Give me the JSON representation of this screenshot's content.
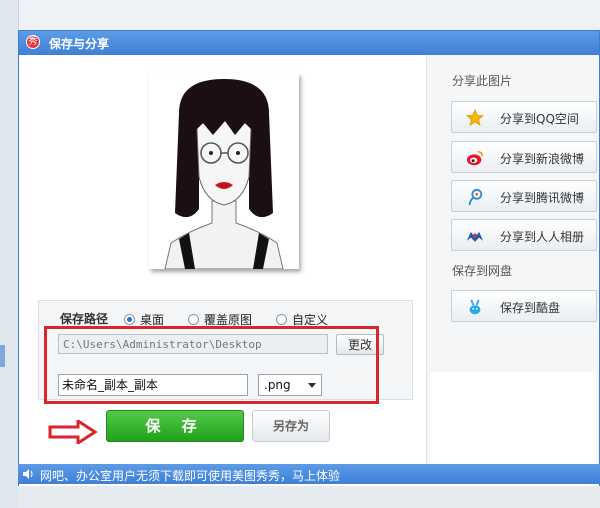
{
  "window": {
    "title": "保存与分享"
  },
  "save_options": {
    "path_label": "保存路径",
    "radios": [
      {
        "label": "桌面",
        "checked": true
      },
      {
        "label": "覆盖原图",
        "checked": false
      },
      {
        "label": "自定义",
        "checked": false
      }
    ],
    "path_value": "C:\\Users\\Administrator\\Desktop",
    "change_label": "更改",
    "filename_value": "未命名_副本_副本",
    "format_value": ".png",
    "save_label": "保 存",
    "save_as_label": "另存为"
  },
  "share": {
    "section_title": "分享此图片",
    "buttons": [
      {
        "label": "分享到QQ空间",
        "icon": "star-icon"
      },
      {
        "label": "分享到新浪微博",
        "icon": "weibo-icon"
      },
      {
        "label": "分享到腾讯微博",
        "icon": "tencent-weibo-icon"
      },
      {
        "label": "分享到人人相册",
        "icon": "renren-icon"
      }
    ],
    "cloud_title": "保存到网盘",
    "cloud_button": {
      "label": "保存到酷盘",
      "icon": "kupan-icon"
    }
  },
  "status": {
    "message": "网吧、办公室用户无须下载即可使用美图秀秀，马上体验"
  },
  "colors": {
    "accent": "#3f80d6",
    "save_green": "#23a01b",
    "highlight_red": "#d9262c"
  }
}
